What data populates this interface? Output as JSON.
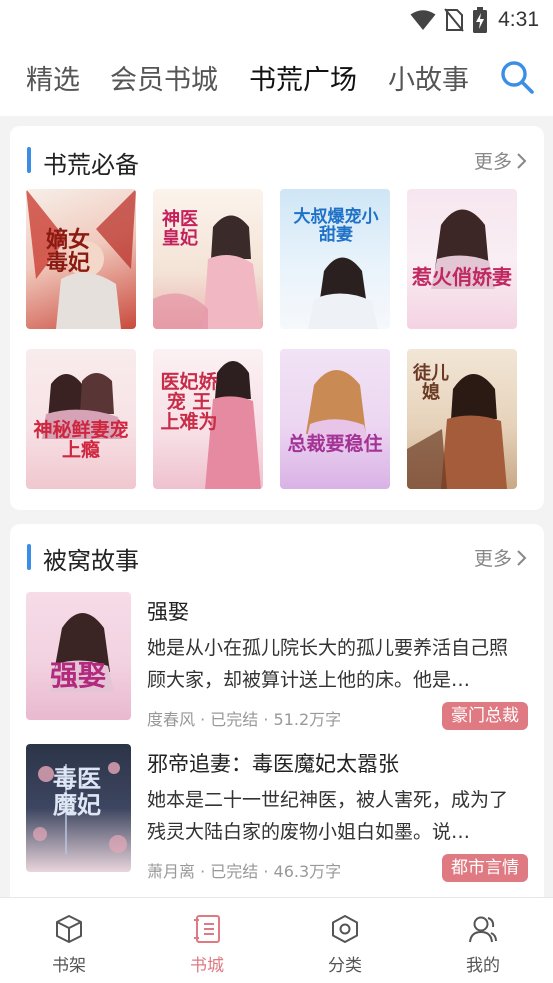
{
  "status_bar": {
    "time": "4:31"
  },
  "top_tabs": [
    {
      "label": "精选"
    },
    {
      "label": "会员书城"
    },
    {
      "label": "书荒广场",
      "active": true
    },
    {
      "label": "小故事"
    }
  ],
  "section1": {
    "title": "书荒必备",
    "more": "更多",
    "books": [
      {
        "cover_text": "嫡女毒妃",
        "cover_color": "#c83a32"
      },
      {
        "cover_text": "神医皇妃",
        "cover_color": "#d9587a"
      },
      {
        "cover_text": "大叔爆宠小甜妻",
        "cover_color": "#2d7fd0"
      },
      {
        "cover_text": "惹火俏娇妻",
        "cover_color": "#c12c6a"
      },
      {
        "cover_text": "神秘鲜妻宠上瘾",
        "cover_color": "#d13a52"
      },
      {
        "cover_text": "医妃娇宠 王上难为",
        "cover_color": "#c9304a"
      },
      {
        "cover_text": "总裁要稳住",
        "cover_color": "#9d3aa8"
      },
      {
        "cover_text": "徒儿媳",
        "cover_color": "#7a4a2a"
      }
    ]
  },
  "section2": {
    "title": "被窝故事",
    "more": "更多",
    "stories": [
      {
        "title": "强娶",
        "desc": "她是从小在孤儿院长大的孤儿要养活自己照顾大家，却被算计送上他的床。他是…",
        "meta": "度春风 · 已完结 · 51.2万字",
        "tag": "豪门总裁",
        "cover_text": "强娶"
      },
      {
        "title": "邪帝追妻：毒医魔妃太嚣张",
        "desc": "她本是二十一世纪神医，被人害死，成为了残灵大陆白家的废物小姐白如墨。说…",
        "meta": "萧月离 · 已完结 · 46.3万字",
        "tag": "都市言情",
        "cover_text": "毒医魔妃"
      }
    ]
  },
  "bottom_nav": [
    {
      "label": "书架",
      "icon": "cube-icon"
    },
    {
      "label": "书城",
      "icon": "book-list-icon",
      "active": true
    },
    {
      "label": "分类",
      "icon": "hexagon-icon"
    },
    {
      "label": "我的",
      "icon": "user-icon"
    }
  ],
  "colors": {
    "accent_blue": "#3a8ee6",
    "accent_pink": "#df7a83"
  }
}
